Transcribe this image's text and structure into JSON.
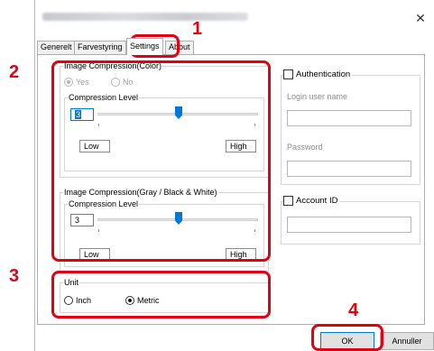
{
  "window": {
    "close_glyph": "✕"
  },
  "tabs": [
    {
      "label": "Generelt"
    },
    {
      "label": "Farvestyring"
    },
    {
      "label": "Settings",
      "active": true
    },
    {
      "label": "About"
    }
  ],
  "color_group": {
    "title": "Image Compression(Color)",
    "options": [
      {
        "label": "Yes",
        "selected": true,
        "enabled": false
      },
      {
        "label": "No",
        "selected": false,
        "enabled": false
      }
    ],
    "level": {
      "title": "Compression Level",
      "value": "3",
      "level_fraction": 0.5,
      "low_label": "Low",
      "high_label": "High"
    }
  },
  "gray_group": {
    "title": "Image Compression(Gray / Black & White)",
    "level": {
      "title": "Compression Level",
      "value": "3",
      "level_fraction": 0.5,
      "low_label": "Low",
      "high_label": "High"
    }
  },
  "auth": {
    "checkbox_label": "Authentication",
    "checked": false,
    "login_label": "Login user name",
    "login_value": "",
    "password_label": "Password",
    "password_value": ""
  },
  "account": {
    "checkbox_label": "Account ID",
    "checked": false,
    "value": ""
  },
  "unit": {
    "title": "Unit",
    "options": [
      {
        "label": "Inch",
        "selected": false
      },
      {
        "label": "Metric",
        "selected": true
      }
    ]
  },
  "buttons": {
    "ok": "OK",
    "cancel": "Annuller"
  },
  "callouts": [
    "1",
    "2",
    "3",
    "4"
  ],
  "colors": {
    "callout": "#e3000f",
    "accent": "#0078d7"
  }
}
